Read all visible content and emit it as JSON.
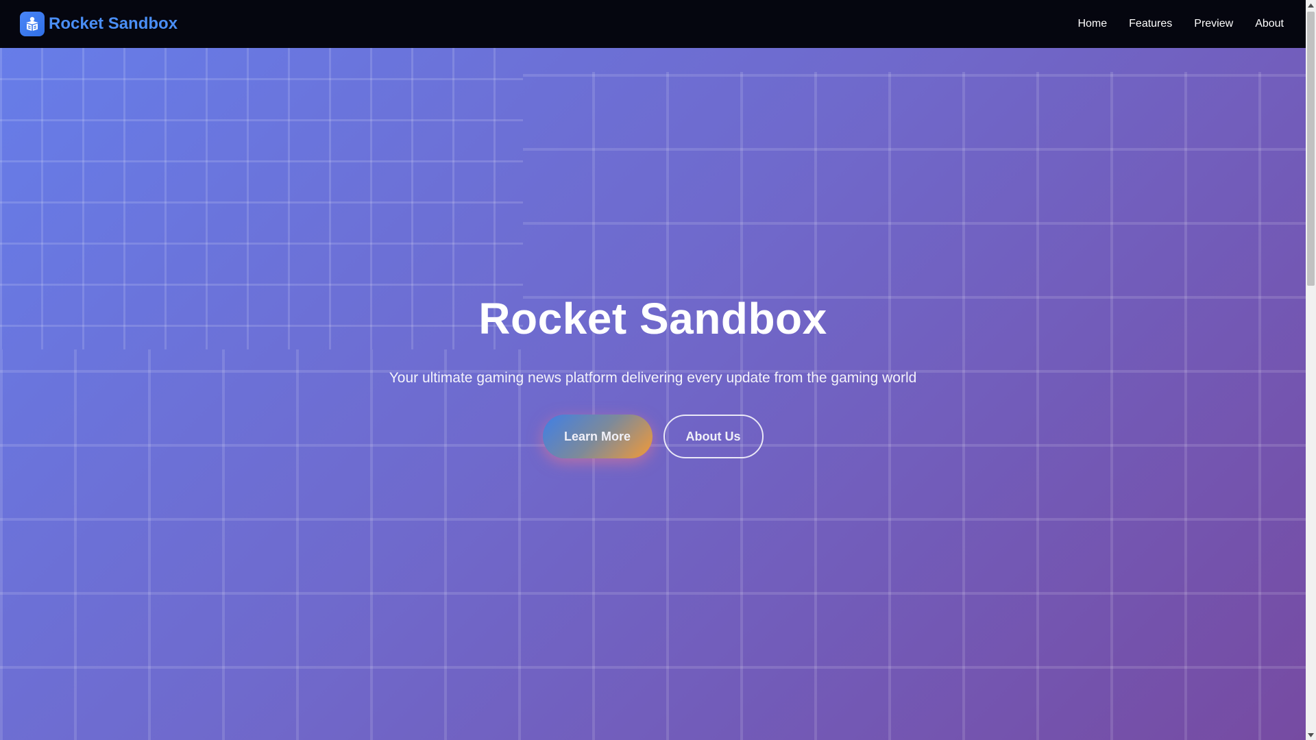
{
  "navbar": {
    "brand_name": "Rocket Sandbox",
    "brand_icon": "gift-box-icon",
    "links": [
      {
        "label": "Home"
      },
      {
        "label": "Features"
      },
      {
        "label": "Preview"
      },
      {
        "label": "About"
      }
    ]
  },
  "hero": {
    "title": "Rocket Sandbox",
    "subtitle": "Your ultimate gaming news platform delivering every update from the gaming world",
    "primary_button": "Learn More",
    "secondary_button": "About Us"
  },
  "colors": {
    "navbar_bg": "#05060f",
    "brand_text": "#4a8ef5",
    "hero_gradient_start": "#667eea",
    "hero_gradient_end": "#764ba2",
    "primary_button_gradient": [
      "#3f7fe6",
      "#f39a36"
    ]
  }
}
